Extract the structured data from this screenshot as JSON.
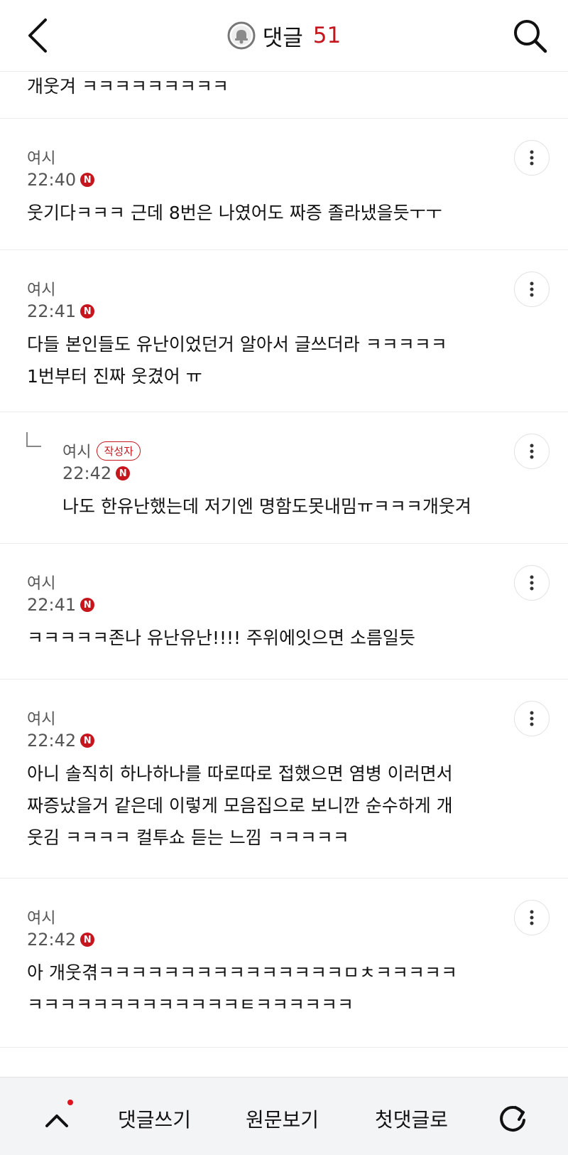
{
  "header": {
    "title": "댓글",
    "count": "51"
  },
  "cut_comment": {
    "text": "개웃겨 ㅋㅋㅋㅋㅋㅋㅋㅋㅋ"
  },
  "comments": [
    {
      "nick": "여시",
      "time": "22:40",
      "badge": "N",
      "lines": [
        "웃기다ㅋㅋㅋ 근데 8번은 나였어도 짜증 졸라냈을듯ㅜㅜ"
      ]
    },
    {
      "nick": "여시",
      "time": "22:41",
      "badge": "N",
      "lines": [
        "다들 본인들도 유난이었던거 알아서 글쓰더라 ㅋㅋㅋㅋㅋ",
        "1번부터 진짜 웃겼어 ㅠ"
      ]
    },
    {
      "nick": "여시",
      "author_badge": "작성자",
      "time": "22:42",
      "badge": "N",
      "lines": [
        "나도 한유난했는데 저기엔 명함도못내밈ㅠㅋㅋㅋ개웃겨"
      ]
    },
    {
      "nick": "여시",
      "time": "22:41",
      "badge": "N",
      "lines": [
        "ㅋㅋㅋㅋㅋ존나 유난유난!!!! 주위에잇으면 소름일듯"
      ]
    },
    {
      "nick": "여시",
      "time": "22:42",
      "badge": "N",
      "lines": [
        "아니 솔직히 하나하나를 따로따로 접했으면 염병 이러면서",
        "짜증났을거 같은데 이렇게 모음집으로 보니깐 순수하게 개",
        "웃김 ㅋㅋㅋㅋ 컬투쇼 듣는 느낌 ㅋㅋㅋㅋㅋ"
      ]
    },
    {
      "nick": "여시",
      "time": "22:42",
      "badge": "N",
      "lines": [
        "아 개웃겪ㅋㅋㅋㅋㅋㅋㅋㅋㅋㅋㅋㅋㅋㅋㅋㅁㅊㅋㅋㅋㅋㅋ",
        "ㅋㅋㅋㅋㅋㅋㅋㅋㅋㅋㅋㅋㅋㅌㅋㅋㅋㅋㅋㅋ"
      ]
    }
  ],
  "bottom_bar": {
    "write_label": "댓글쓰기",
    "original_label": "원문보기",
    "first_label": "첫댓글로"
  },
  "colors": {
    "accent": "#c4161c",
    "bar_bg": "#f3f4f6"
  },
  "icons": [
    "back-arrow-icon",
    "bell-icon",
    "search-icon",
    "more-vert-icon",
    "reply-arrow-icon",
    "chevron-up-icon",
    "refresh-icon"
  ]
}
